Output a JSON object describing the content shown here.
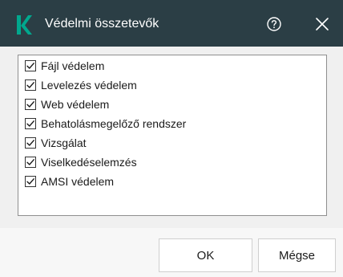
{
  "window": {
    "title": "Védelmi összetevők",
    "logo_icon": "kaspersky-k-logo",
    "accent_color": "#00a88e",
    "titlebar_color": "#2b3e45"
  },
  "components": {
    "items": [
      {
        "label": "Fájl védelem",
        "checked": true
      },
      {
        "label": "Levelezés védelem",
        "checked": true
      },
      {
        "label": "Web védelem",
        "checked": true
      },
      {
        "label": "Behatolásmegelőző rendszer",
        "checked": true
      },
      {
        "label": "Vizsgálat",
        "checked": true
      },
      {
        "label": "Viselkedéselemzés",
        "checked": true
      },
      {
        "label": "AMSI védelem",
        "checked": true
      }
    ]
  },
  "footer": {
    "ok_label": "OK",
    "cancel_label": "Mégse"
  }
}
